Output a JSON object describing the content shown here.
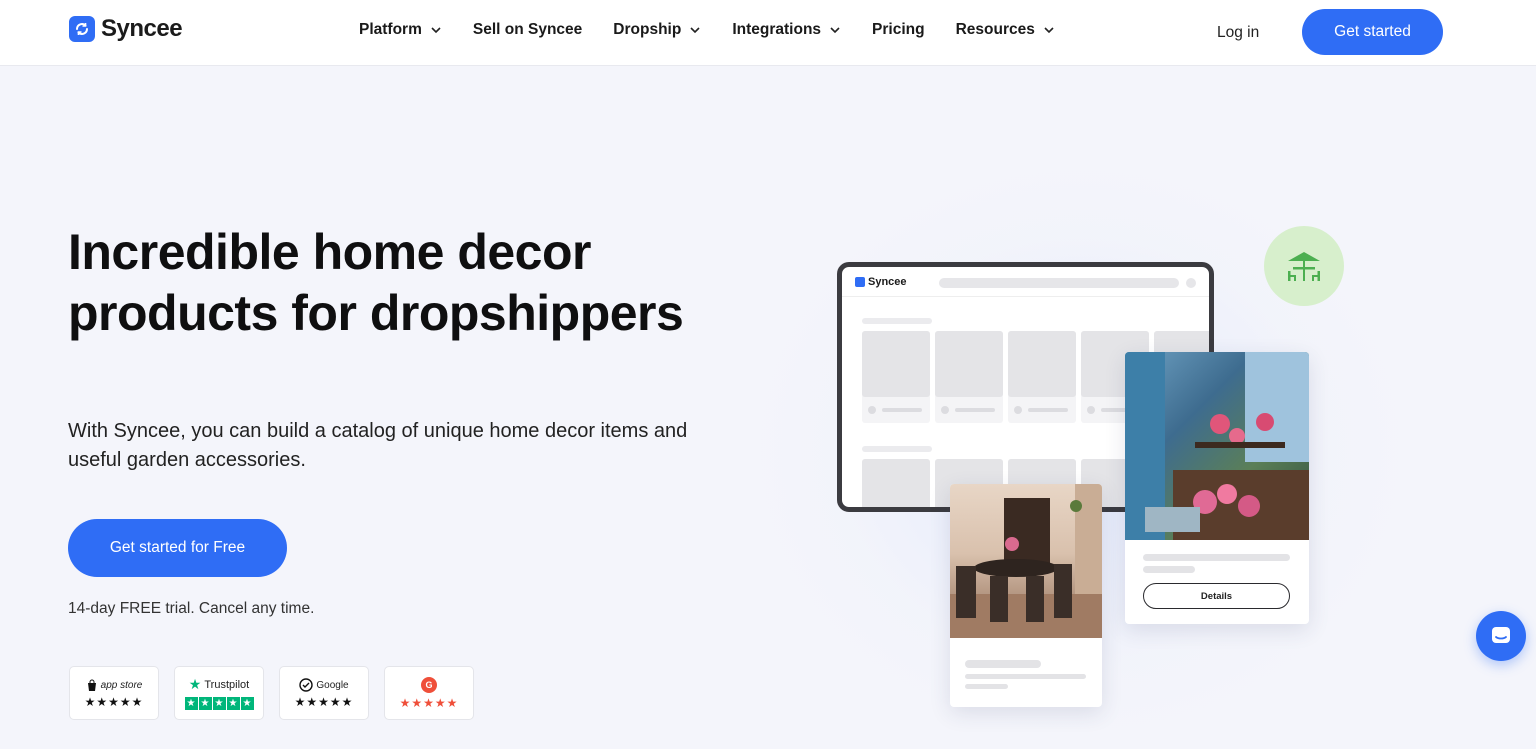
{
  "brand": {
    "name": "Syncee",
    "color": "#2f6df5"
  },
  "nav": {
    "items": [
      {
        "label": "Platform",
        "has_dropdown": true
      },
      {
        "label": "Sell on Syncee",
        "has_dropdown": false
      },
      {
        "label": "Dropship",
        "has_dropdown": true
      },
      {
        "label": "Integrations",
        "has_dropdown": true
      },
      {
        "label": "Pricing",
        "has_dropdown": false
      },
      {
        "label": "Resources",
        "has_dropdown": true
      }
    ],
    "login_label": "Log in",
    "cta_label": "Get started"
  },
  "hero": {
    "title": "Incredible home decor products for dropshippers",
    "subtitle": "With Syncee, you can build a catalog of unique home decor items and useful garden accessories.",
    "cta_label": "Get started for Free",
    "trial_note": "14-day FREE trial. Cancel any time."
  },
  "badges": [
    {
      "name": "app store",
      "stars": "★★★★★"
    },
    {
      "name": "Trustpilot",
      "stars": "★★★★★"
    },
    {
      "name": "Google",
      "stars": "★★★★★"
    },
    {
      "name": "G2",
      "stars": "★★★★★"
    }
  ],
  "illustration": {
    "tablet_logo": "Syncee",
    "details_label": "Details",
    "accent_green": "#d7efcc"
  },
  "chat": {
    "icon": "chat-icon"
  }
}
